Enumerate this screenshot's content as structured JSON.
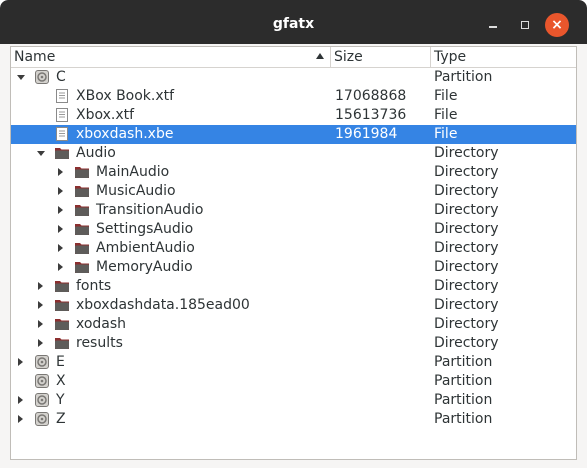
{
  "window": {
    "title": "gfatx"
  },
  "columns": {
    "name": "Name",
    "size": "Size",
    "type": "Type"
  },
  "rows": [
    {
      "name": "C",
      "size": "",
      "type": "Partition",
      "kind": "partition",
      "level": 0,
      "expander": "open",
      "selected": false
    },
    {
      "name": "XBox Book.xtf",
      "size": "17068868",
      "type": "File",
      "kind": "file",
      "level": 1,
      "expander": "none",
      "selected": false
    },
    {
      "name": "Xbox.xtf",
      "size": "15613736",
      "type": "File",
      "kind": "file",
      "level": 1,
      "expander": "none",
      "selected": false
    },
    {
      "name": "xboxdash.xbe",
      "size": "1961984",
      "type": "File",
      "kind": "file",
      "level": 1,
      "expander": "none",
      "selected": true
    },
    {
      "name": "Audio",
      "size": "",
      "type": "Directory",
      "kind": "folder",
      "level": 1,
      "expander": "open",
      "selected": false
    },
    {
      "name": "MainAudio",
      "size": "",
      "type": "Directory",
      "kind": "folder",
      "level": 2,
      "expander": "closed",
      "selected": false
    },
    {
      "name": "MusicAudio",
      "size": "",
      "type": "Directory",
      "kind": "folder",
      "level": 2,
      "expander": "closed",
      "selected": false
    },
    {
      "name": "TransitionAudio",
      "size": "",
      "type": "Directory",
      "kind": "folder",
      "level": 2,
      "expander": "closed",
      "selected": false
    },
    {
      "name": "SettingsAudio",
      "size": "",
      "type": "Directory",
      "kind": "folder",
      "level": 2,
      "expander": "closed",
      "selected": false
    },
    {
      "name": "AmbientAudio",
      "size": "",
      "type": "Directory",
      "kind": "folder",
      "level": 2,
      "expander": "closed",
      "selected": false
    },
    {
      "name": "MemoryAudio",
      "size": "",
      "type": "Directory",
      "kind": "folder",
      "level": 2,
      "expander": "closed",
      "selected": false
    },
    {
      "name": "fonts",
      "size": "",
      "type": "Directory",
      "kind": "folder",
      "level": 1,
      "expander": "closed",
      "selected": false
    },
    {
      "name": "xboxdashdata.185ead00",
      "size": "",
      "type": "Directory",
      "kind": "folder",
      "level": 1,
      "expander": "closed",
      "selected": false
    },
    {
      "name": "xodash",
      "size": "",
      "type": "Directory",
      "kind": "folder",
      "level": 1,
      "expander": "closed",
      "selected": false
    },
    {
      "name": "results",
      "size": "",
      "type": "Directory",
      "kind": "folder",
      "level": 1,
      "expander": "closed",
      "selected": false
    },
    {
      "name": "E",
      "size": "",
      "type": "Partition",
      "kind": "partition",
      "level": 0,
      "expander": "closed",
      "selected": false
    },
    {
      "name": "X",
      "size": "",
      "type": "Partition",
      "kind": "partition",
      "level": 0,
      "expander": "none",
      "selected": false
    },
    {
      "name": "Y",
      "size": "",
      "type": "Partition",
      "kind": "partition",
      "level": 0,
      "expander": "closed",
      "selected": false
    },
    {
      "name": "Z",
      "size": "",
      "type": "Partition",
      "kind": "partition",
      "level": 0,
      "expander": "closed",
      "selected": false
    }
  ],
  "colors": {
    "titlebar": "#2c2c2c",
    "close_button": "#e9562c",
    "selection": "#3584e4",
    "folder": "#8c2f2f"
  }
}
